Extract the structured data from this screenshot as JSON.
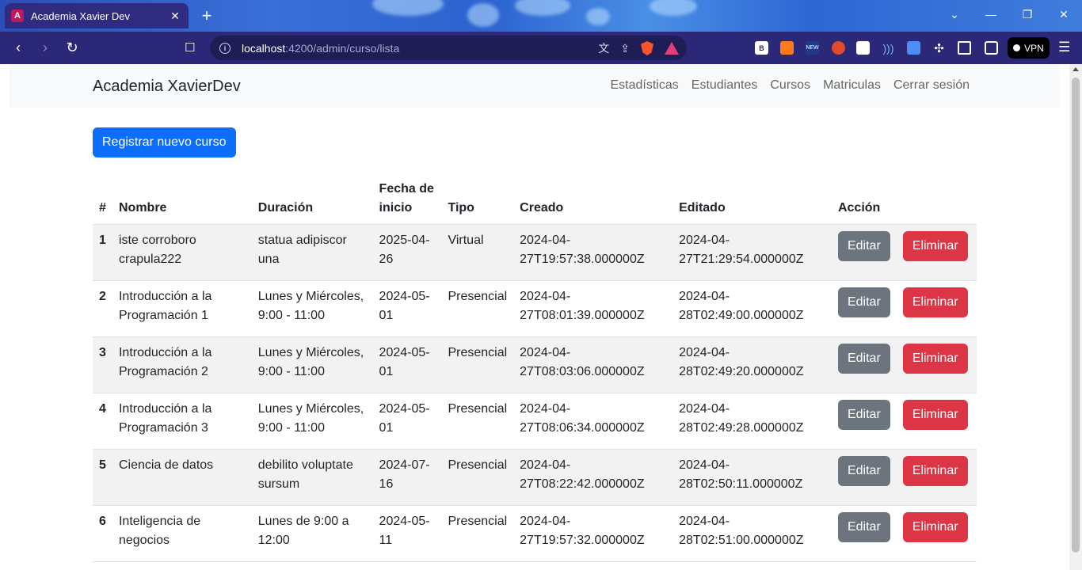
{
  "browser": {
    "tab_title": "Academia Xavier Dev",
    "tab_favicon": "A",
    "url_host": "localhost",
    "url_path": ":4200/admin/curso/lista",
    "vpn_label": "VPN",
    "ext_b": "B",
    "ext_new": "NEW"
  },
  "navbar": {
    "brand": "Academia XavierDev",
    "links": [
      "Estadísticas",
      "Estudiantes",
      "Cursos",
      "Matriculas",
      "Cerrar sesión"
    ]
  },
  "actions": {
    "new_course": "Registrar nuevo curso"
  },
  "table": {
    "headers": {
      "num": "#",
      "nombre": "Nombre",
      "duracion": "Duración",
      "fecha": "Fecha de inicio",
      "tipo": "Tipo",
      "creado": "Creado",
      "editado": "Editado",
      "accion": "Acción"
    },
    "edit_label": "Editar",
    "delete_label": "Eliminar",
    "rows": [
      {
        "num": "1",
        "nombre": "iste corroboro crapula222",
        "duracion": "statua adipiscor una",
        "fecha": "2025-04-26",
        "tipo": "Virtual",
        "creado": "2024-04-27T19:57:38.000000Z",
        "editado": "2024-04-27T21:29:54.000000Z"
      },
      {
        "num": "2",
        "nombre": "Introducción a la Programación 1",
        "duracion": "Lunes y Miércoles, 9:00 - 11:00",
        "fecha": "2024-05-01",
        "tipo": "Presencial",
        "creado": "2024-04-27T08:01:39.000000Z",
        "editado": "2024-04-28T02:49:00.000000Z"
      },
      {
        "num": "3",
        "nombre": "Introducción a la Programación 2",
        "duracion": "Lunes y Miércoles, 9:00 - 11:00",
        "fecha": "2024-05-01",
        "tipo": "Presencial",
        "creado": "2024-04-27T08:03:06.000000Z",
        "editado": "2024-04-28T02:49:20.000000Z"
      },
      {
        "num": "4",
        "nombre": "Introducción a la Programación 3",
        "duracion": "Lunes y Miércoles, 9:00 - 11:00",
        "fecha": "2024-05-01",
        "tipo": "Presencial",
        "creado": "2024-04-27T08:06:34.000000Z",
        "editado": "2024-04-28T02:49:28.000000Z"
      },
      {
        "num": "5",
        "nombre": "Ciencia de datos",
        "duracion": "debilito voluptate sursum",
        "fecha": "2024-07-16",
        "tipo": "Presencial",
        "creado": "2024-04-27T08:22:42.000000Z",
        "editado": "2024-04-28T02:50:11.000000Z"
      },
      {
        "num": "6",
        "nombre": "Inteligencia de negocios",
        "duracion": "Lunes de 9:00 a 12:00",
        "fecha": "2024-05-11",
        "tipo": "Presencial",
        "creado": "2024-04-27T19:57:32.000000Z",
        "editado": "2024-04-28T02:51:00.000000Z"
      }
    ]
  },
  "colors": {
    "primary": "#0d6efd",
    "secondary": "#6c757d",
    "danger": "#dc3545",
    "toolbar": "#2b2878"
  }
}
